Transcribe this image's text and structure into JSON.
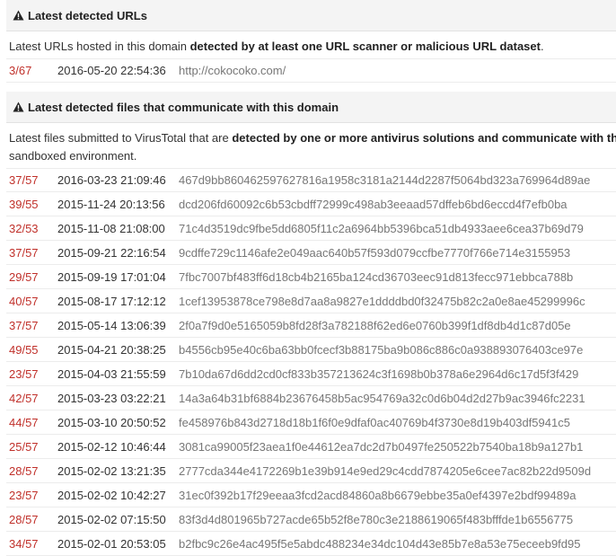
{
  "urls_section": {
    "title": "Latest detected URLs",
    "desc_plain": "Latest URLs hosted in this domain ",
    "desc_bold": "detected by at least one URL scanner or malicious URL dataset",
    "desc_tail": ".",
    "rows": [
      {
        "ratio": "3/67",
        "date": "2016-05-20 22:54:36",
        "url": "http://cokocoko.com/"
      }
    ]
  },
  "files_section": {
    "title": "Latest detected files that communicate with this domain",
    "desc_plain": "Latest files submitted to VirusTotal that are ",
    "desc_bold": "detected by one or more antivirus solutions and communicate with th",
    "desc_line2": "sandboxed environment.",
    "rows": [
      {
        "ratio": "37/57",
        "date": "2016-03-23 21:09:46",
        "hash": "467d9bb860462597627816a1958c3181a2144d2287f5064bd323a769964d89ae"
      },
      {
        "ratio": "39/55",
        "date": "2015-11-24 20:13:56",
        "hash": "dcd206fd60092c6b53cbdff72999c498ab3eeaad57dffeb6bd6eccd4f7efb0ba"
      },
      {
        "ratio": "32/53",
        "date": "2015-11-08 21:08:00",
        "hash": "71c4d3519dc9fbe5dd6805f11c2a6964bb5396bca51db4933aee6cea37b69d79"
      },
      {
        "ratio": "37/57",
        "date": "2015-09-21 22:16:54",
        "hash": "9cdffe729c1146afe2e049aac640b57f593d079ccfbe7770f766e714e3155953"
      },
      {
        "ratio": "29/57",
        "date": "2015-09-19 17:01:04",
        "hash": "7fbc7007bf483ff6d18cb4b2165ba124cd36703eec91d813fecc971ebbca788b"
      },
      {
        "ratio": "40/57",
        "date": "2015-08-17 17:12:12",
        "hash": "1cef13953878ce798e8d7aa8a9827e1ddddbd0f32475b82c2a0e8ae45299996c"
      },
      {
        "ratio": "37/57",
        "date": "2015-05-14 13:06:39",
        "hash": "2f0a7f9d0e5165059b8fd28f3a782188f62ed6e0760b399f1df8db4d1c87d05e"
      },
      {
        "ratio": "49/55",
        "date": "2015-04-21 20:38:25",
        "hash": "b4556cb95e40c6ba63bb0fcecf3b88175ba9b086c886c0a938893076403ce97e"
      },
      {
        "ratio": "23/57",
        "date": "2015-04-03 21:55:59",
        "hash": "7b10da67d6dd2cd0cf833b357213624c3f1698b0b378a6e2964d6c17d5f3f429"
      },
      {
        "ratio": "42/57",
        "date": "2015-03-23 03:22:21",
        "hash": "14a3a64b31bf6884b23676458b5ac954769a32c0d6b04d2d27b9ac3946fc2231"
      },
      {
        "ratio": "44/57",
        "date": "2015-03-10 20:50:52",
        "hash": "fe458976b843d2718d18b1f6f0e9dfaf0ac40769b4f3730e8d19b403df5941c5"
      },
      {
        "ratio": "25/57",
        "date": "2015-02-12 10:46:44",
        "hash": "3081ca99005f23aea1f0e44612ea7dc2d7b0497fe250522b7540ba18b9a127b1"
      },
      {
        "ratio": "28/57",
        "date": "2015-02-02 13:21:35",
        "hash": "2777cda344e4172269b1e39b914e9ed29c4cdd7874205e6cee7ac82b22d9509d"
      },
      {
        "ratio": "23/57",
        "date": "2015-02-02 10:42:27",
        "hash": "31ec0f392b17f29eeaa3fcd2acd84860a8b6679ebbe35a0ef4397e2bdf99489a"
      },
      {
        "ratio": "28/57",
        "date": "2015-02-02 07:15:50",
        "hash": "83f3d4d801965b727acde65b52f8e780c3e2188619065f483bfffde1b6556775"
      },
      {
        "ratio": "34/57",
        "date": "2015-02-01 20:53:05",
        "hash": "b2fbc9c26e4ac495f5e5abdc488234e34dc104d43e85b7e8a53e75eceeb9fd95"
      }
    ]
  },
  "colors": {
    "ratio": "#c0302a",
    "header_bg": "#f4f4f4",
    "muted": "#777777"
  },
  "icons": {
    "section": "warning-triangle-icon"
  }
}
